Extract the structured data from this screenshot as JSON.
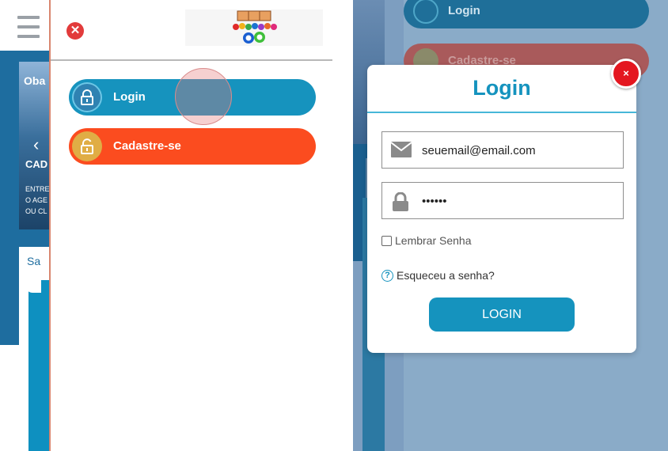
{
  "left": {
    "bg_banner": {
      "partial_brand": "Oba",
      "partial_heading": "CAD",
      "partial_lines": [
        "ENTRE",
        "O AGE",
        "OU CL"
      ]
    },
    "bg_section": {
      "partial_label": "Sa"
    },
    "menu": {
      "login_label": "Login",
      "register_label": "Cadastre-se"
    },
    "colors": {
      "login": "#1693be",
      "register": "#fb4c1f",
      "close": "#e23b3b"
    }
  },
  "right": {
    "bg_menu": {
      "login_label": "Login",
      "register_label": "Cadastre-se"
    },
    "modal": {
      "title": "Login",
      "close_glyph": "×",
      "email_value": "seuemail@email.com",
      "password_value": "••••••",
      "remember_label": "Lembrar Senha",
      "forgot_label": "Esqueceu a senha?",
      "submit_label": "LOGIN"
    },
    "colors": {
      "accent": "#1593be",
      "close": "#e4161f"
    }
  },
  "icons": [
    "hamburger-icon",
    "close-icon",
    "lock-icon",
    "unlock-icon",
    "envelope-icon",
    "question-icon"
  ]
}
